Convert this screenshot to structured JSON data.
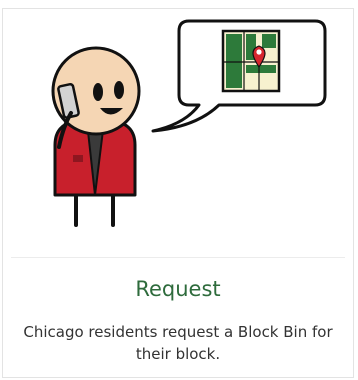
{
  "card": {
    "title": "Request",
    "description": "Chicago residents request a Block Bin for their block."
  },
  "colors": {
    "title": "#2e6b3c",
    "jacket": "#c8202c",
    "map_green": "#2d7a3a",
    "pin": "#d6262e"
  },
  "icons": {
    "illustration": "person-on-phone-illustration",
    "bubble": "speech-bubble-icon",
    "map": "map-icon",
    "pin": "map-pin-icon"
  }
}
